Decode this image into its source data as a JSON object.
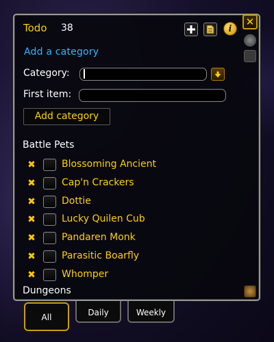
{
  "header": {
    "title": "Todo",
    "count": "38",
    "close_glyph": "✕",
    "info_glyph": "i"
  },
  "form": {
    "add_category_link": "Add a category",
    "category_label": "Category:",
    "category_value": "",
    "first_item_label": "First item:",
    "first_item_value": "",
    "add_category_button": "Add category"
  },
  "sections": [
    {
      "title": "Battle Pets",
      "items": [
        {
          "name": "Blossoming Ancient",
          "checked": false
        },
        {
          "name": "Cap'n Crackers",
          "checked": false
        },
        {
          "name": "Dottie",
          "checked": false
        },
        {
          "name": "Lucky Quilen Cub",
          "checked": false
        },
        {
          "name": "Pandaren Monk",
          "checked": false
        },
        {
          "name": "Parasitic Boarfly",
          "checked": false
        },
        {
          "name": "Whomper",
          "checked": false
        }
      ]
    },
    {
      "title": "Dungeons",
      "items": []
    }
  ],
  "tabs": [
    {
      "label": "All",
      "selected": true
    },
    {
      "label": "Daily",
      "selected": false
    },
    {
      "label": "Weekly",
      "selected": false
    }
  ],
  "icons": {
    "add": "plus-icon",
    "list": "document-icon",
    "info": "info-icon",
    "close": "close-icon",
    "dropdown": "arrow-down-icon",
    "remove": "remove-x-icon"
  },
  "colors": {
    "title": "#ffd100",
    "link": "#2fb8ff",
    "item": "#ffd100",
    "remove": "#ffc800"
  }
}
